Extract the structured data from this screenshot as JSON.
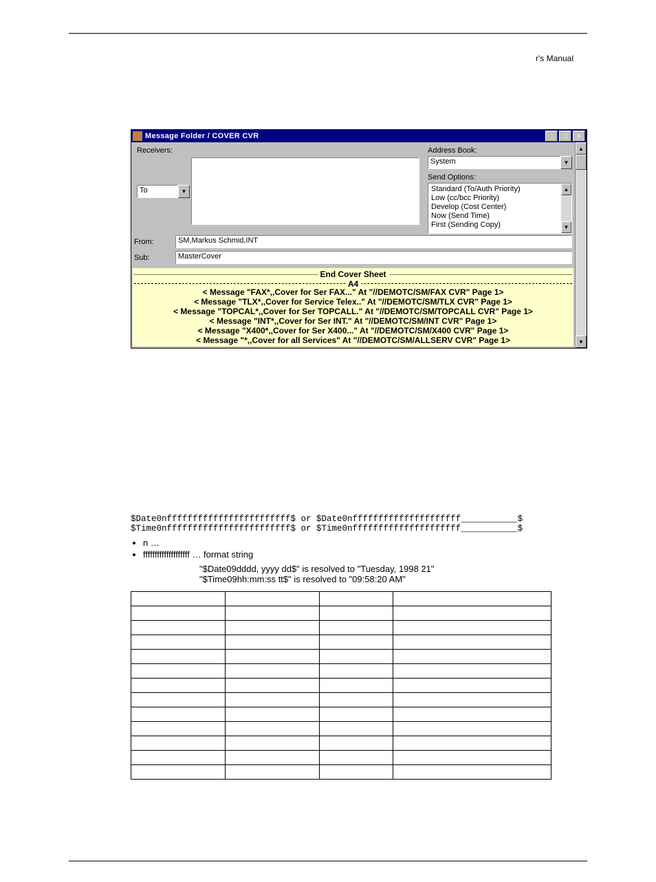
{
  "header_right": "r's Manual",
  "window": {
    "title": "Message Folder / COVER   CVR",
    "receivers_label": "Receivers:",
    "to_label": "To",
    "from_label": "From:",
    "from_value": "SM,Markus Schmid,INT",
    "sub_label": "Sub:",
    "sub_value": "MasterCover",
    "addrbook_label": "Address Book:",
    "addrbook_value": "System",
    "sendopt_label": "Send Options:",
    "sendopt_items": [
      "Standard   (To/Auth Priority)",
      "Low   (cc/bcc Priority)",
      "Develop   (Cost Center)",
      "Now   (Send Time)",
      "First   (Sending Copy)"
    ],
    "end_cover": "End Cover Sheet",
    "a4_label": "A4",
    "messages": [
      "< Message \"FAX*,,Cover for Ser FAX...\" At \"//DEMOTC/SM/FAX    CVR\" Page 1>",
      "< Message \"TLX*,,Cover for Service Telex..\" At \"//DEMOTC/SM/TLX    CVR\" Page 1>",
      "< Message \"TOPCAL*,,Cover for Ser TOPCALL.\" At \"//DEMOTC/SM/TOPCALL CVR\" Page 1>",
      "< Message \"INT*,,Cover for Ser INT.\" At \"//DEMOTC/SM/INT    CVR\" Page 1>",
      "< Message \"X400*,,Cover for Ser X400...\" At \"//DEMOTC/SM/X400    CVR\" Page 1>",
      "< Message \"*,,Cover for all Services\" At \"//DEMOTC/SM/ALLSERV CVR\" Page 1>"
    ]
  },
  "syntax_lines": [
    "$Date0nffffffffffffffffffffffff$ or $Date0nfffffffffffffffffffff___________$",
    "$Time0nffffffffffffffffffffffff$ or $Time0nfffffffffffffffffffff___________$"
  ],
  "bullets": [
    "n …",
    "ffffffffffffffffffff … format string"
  ],
  "example1": "\"$Date09dddd, yyyy          dd$\" is resolved to \"Tuesday, 1998        21\"",
  "example2": "\"$Time09hh:mm:ss tt$\" is resolved to \"09:58:20 AM\"",
  "table_rows": 13,
  "table_cols": 4
}
